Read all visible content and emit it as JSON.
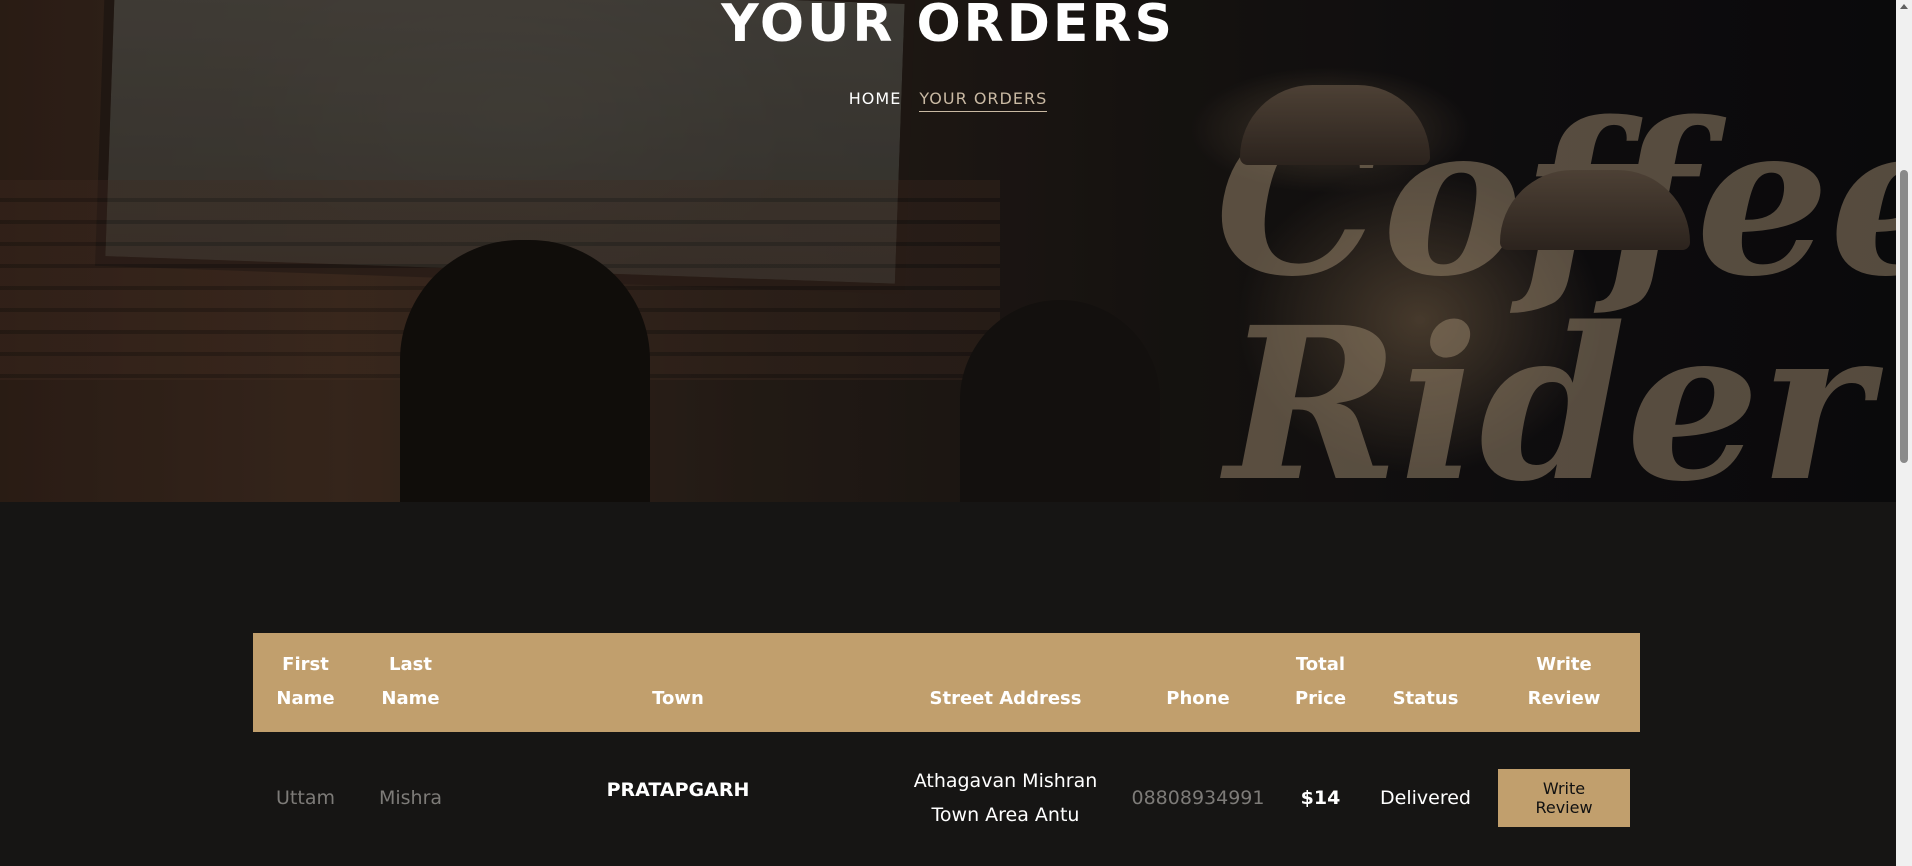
{
  "header": {
    "title": "YOUR ORDERS",
    "breadcrumb": {
      "home": "HOME",
      "current": "YOUR ORDERS"
    }
  },
  "hero_sign": [
    "Coffee",
    "Rider"
  ],
  "table": {
    "headers": {
      "first_name": [
        "First",
        "Name"
      ],
      "last_name": [
        "Last",
        "Name"
      ],
      "town": "Town",
      "street": "Street Address",
      "phone": "Phone",
      "total": [
        "Total",
        "Price"
      ],
      "status": "Status",
      "review": "Write Review"
    },
    "rows": [
      {
        "first_name": "Uttam",
        "last_name": "Mishra",
        "town": "PRATAPGARH",
        "street": [
          "Athagavan Mishran",
          "Town Area Antu"
        ],
        "phone": "08808934991",
        "total": "$14",
        "status": "Delivered",
        "review_button": "Write Review"
      }
    ]
  },
  "colors": {
    "accent": "#c19f6d",
    "background": "#161514"
  }
}
